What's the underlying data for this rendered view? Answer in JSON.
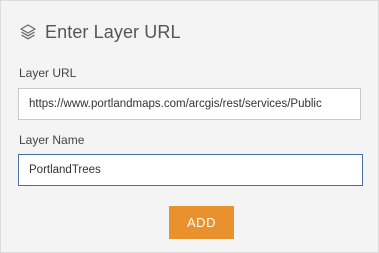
{
  "header": {
    "icon": "layers-icon",
    "title": "Enter Layer URL"
  },
  "layer_url": {
    "label": "Layer URL",
    "value": "https://www.portlandmaps.com/arcgis/rest/services/Public"
  },
  "layer_name": {
    "label": "Layer Name",
    "value": "PortlandTrees"
  },
  "add_button": {
    "label": "ADD",
    "color": "#e8912d"
  }
}
